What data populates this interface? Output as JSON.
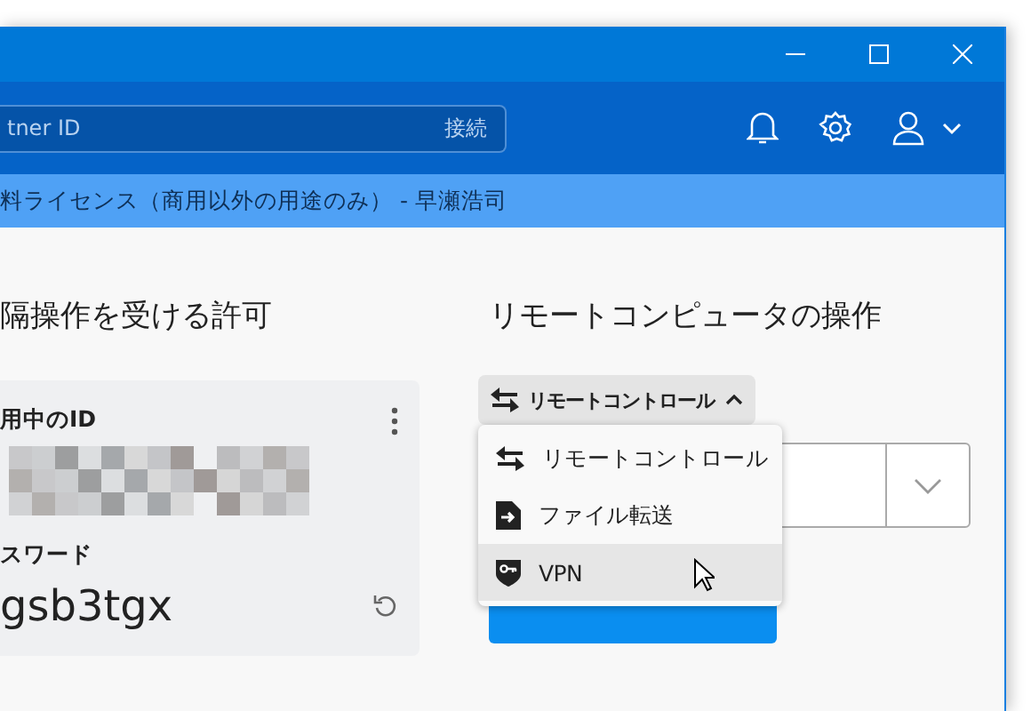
{
  "toolbar": {
    "partner_field": {
      "placeholder": "tner ID",
      "action": "接続"
    }
  },
  "license_bar": {
    "text": "料ライセンス（商用以外の用途のみ） - 早瀬浩司"
  },
  "allow_panel": {
    "heading": "隔操作を受ける許可",
    "id_label": "用中のID",
    "password_label": "スワード",
    "password": "gsb3tgx"
  },
  "remote_panel": {
    "heading": "リモートコンピュータの操作",
    "mode_button": {
      "label": "リモートコントロール",
      "expanded": true
    },
    "menu": [
      {
        "kind": "remote",
        "label": "リモートコントロール",
        "selected": false
      },
      {
        "kind": "file",
        "label": "ファイル転送",
        "selected": false
      },
      {
        "kind": "vpn",
        "label": "VPN",
        "selected": true
      }
    ]
  }
}
